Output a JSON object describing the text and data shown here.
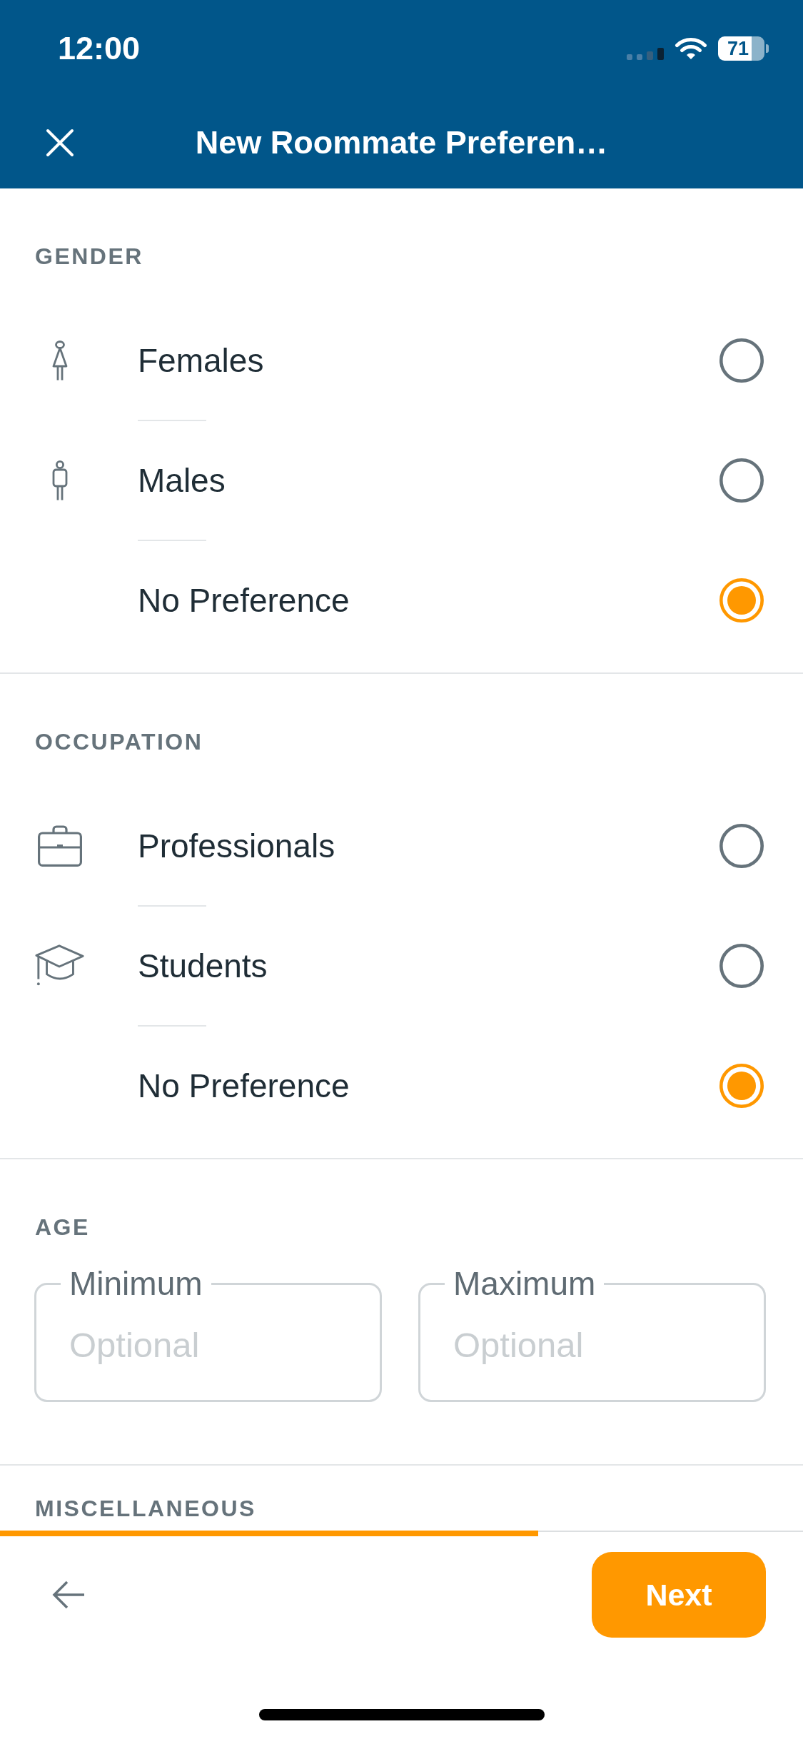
{
  "status_bar": {
    "time": "12:00",
    "battery": "71"
  },
  "header": {
    "title": "New Roommate Preferen…"
  },
  "sections": [
    {
      "kind": "choices",
      "heading": "GENDER",
      "options": [
        {
          "label": "Females",
          "selected": false
        },
        {
          "label": "Males",
          "selected": false
        },
        {
          "label": "No Preference",
          "selected": true
        }
      ]
    },
    {
      "kind": "choices",
      "heading": "OCCUPATION",
      "options": [
        {
          "label": "Professionals",
          "selected": false
        },
        {
          "label": "Students",
          "selected": false
        },
        {
          "label": "No Preference",
          "selected": true
        }
      ]
    },
    {
      "kind": "range",
      "heading": "AGE",
      "fields": [
        {
          "label": "Minimum",
          "placeholder": "Optional"
        },
        {
          "label": "Maximum",
          "placeholder": "Optional"
        }
      ]
    },
    {
      "kind": "heading",
      "heading": "MISCELLANEOUS"
    }
  ],
  "progress": {
    "level": 0.67
  },
  "footer": {
    "next_button": "Next"
  }
}
